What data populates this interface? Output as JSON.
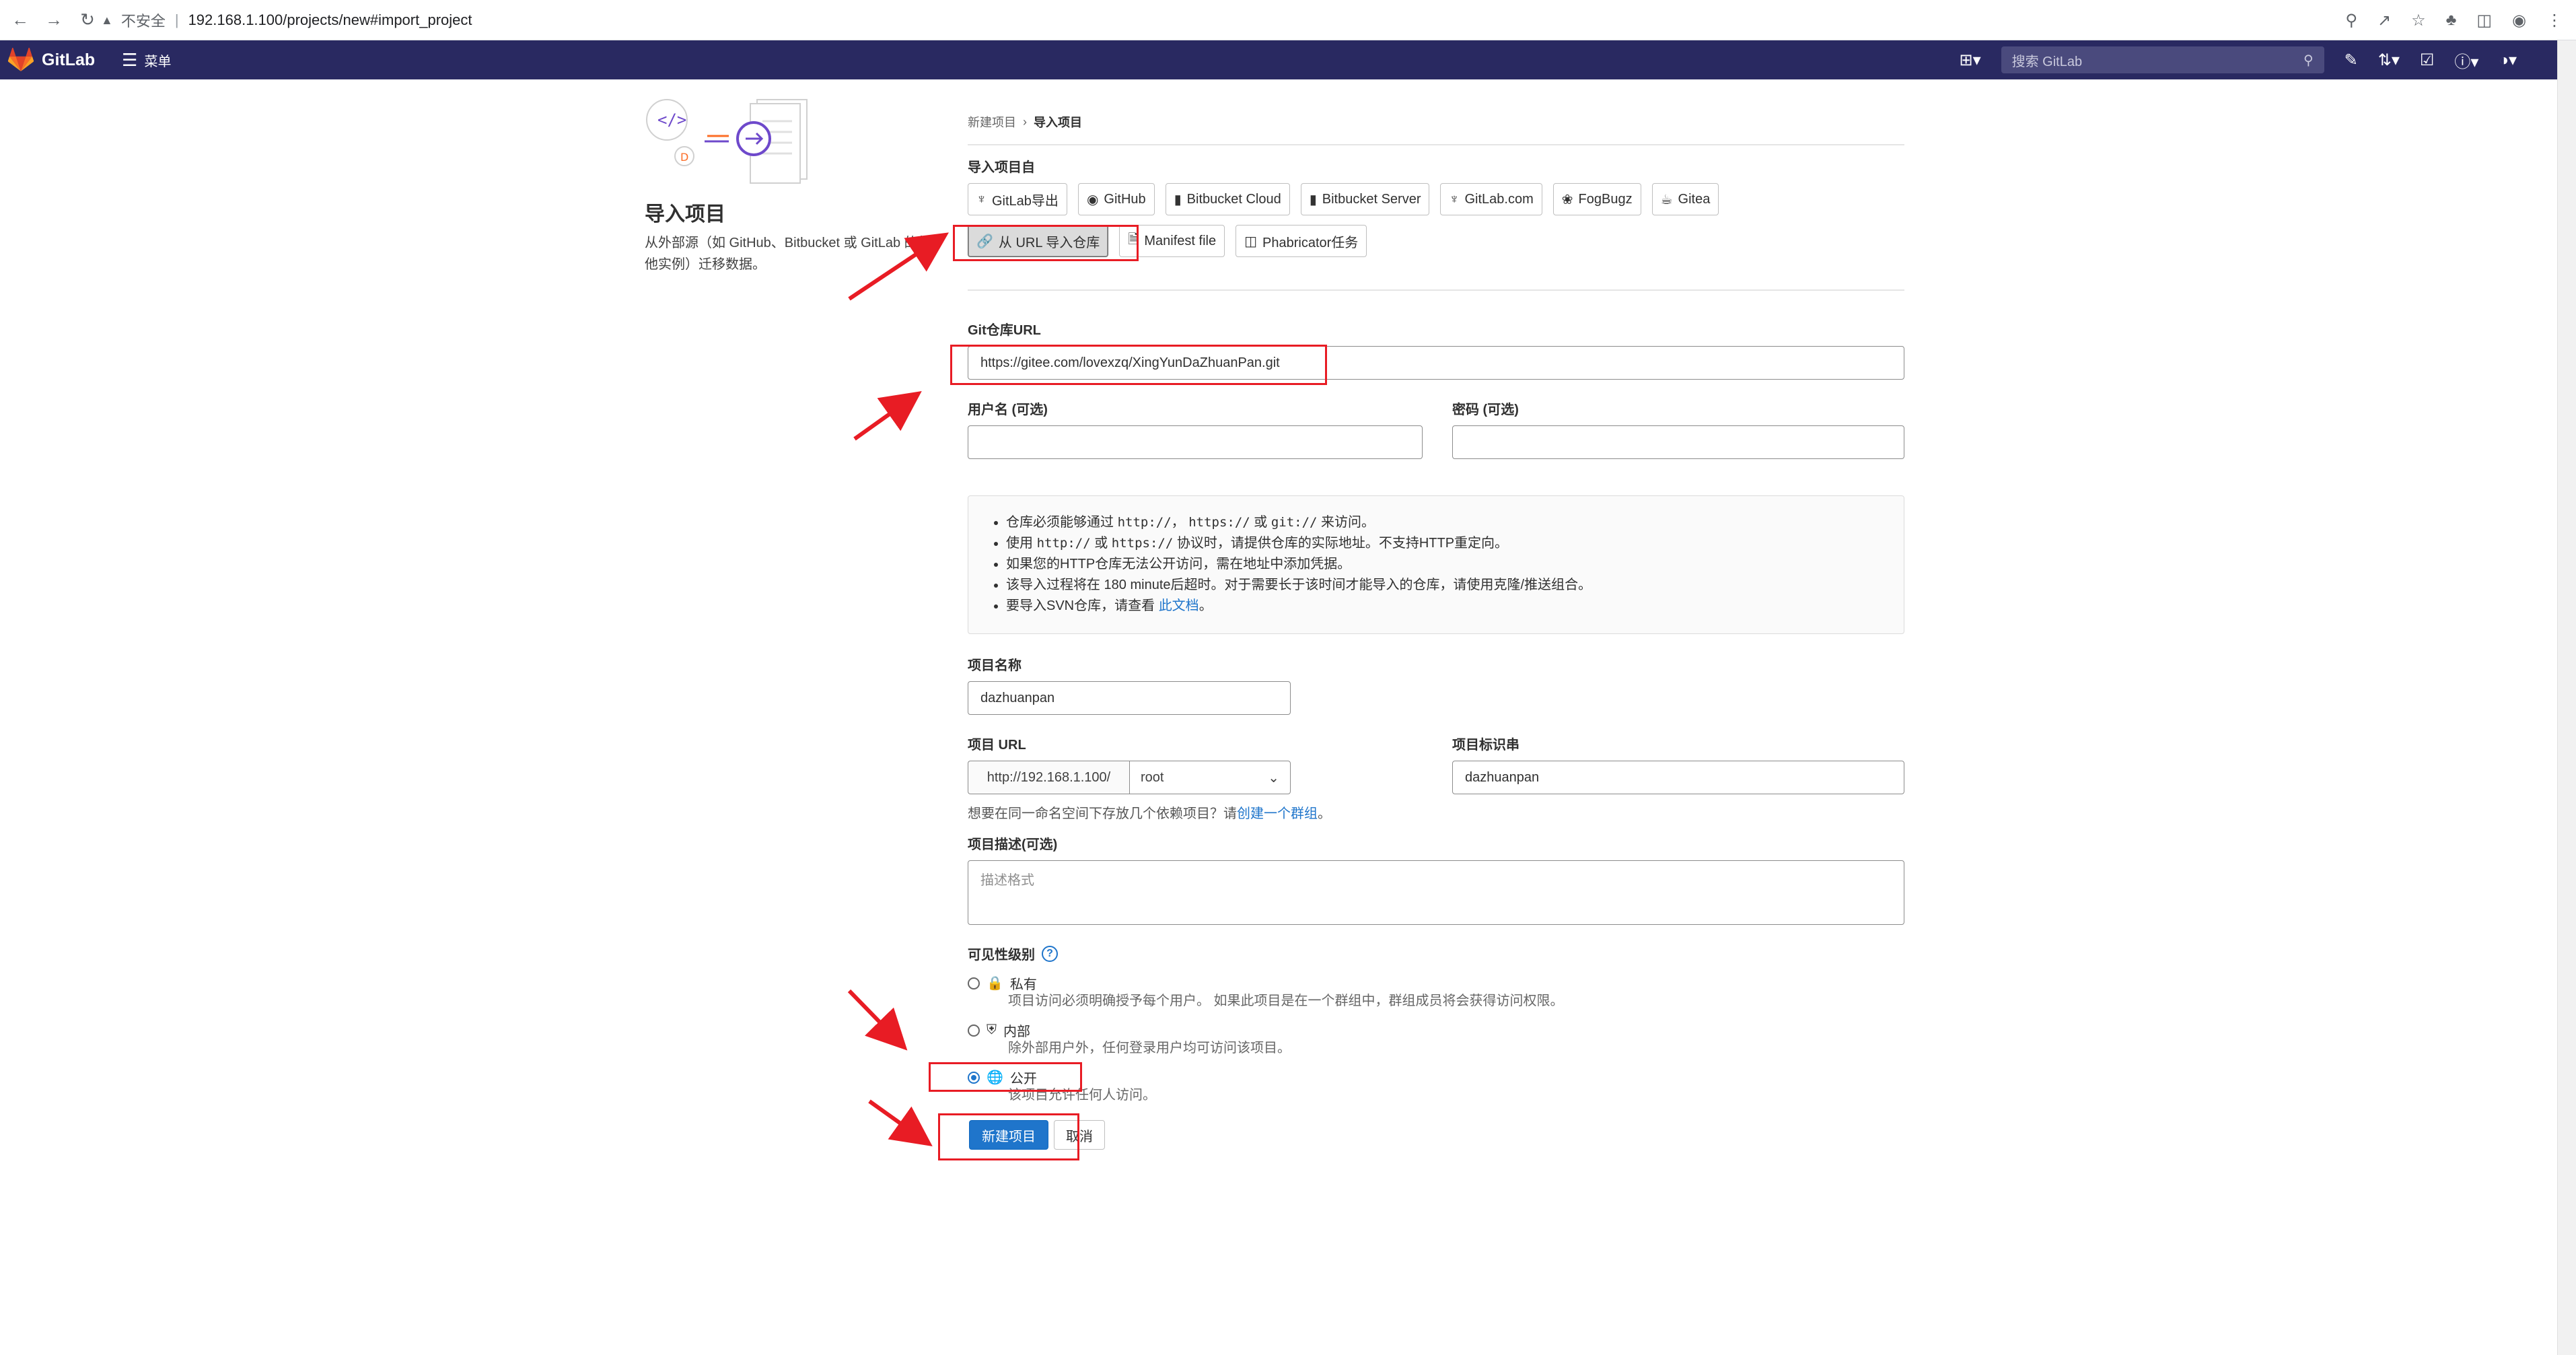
{
  "browser": {
    "back_icon": "arrow-left-icon",
    "forward_icon": "arrow-right-icon",
    "reload_icon": "reload-icon",
    "insecure_label": "不安全",
    "url": "192.168.1.100/projects/new#import_project"
  },
  "gitlab_nav": {
    "brand": "GitLab",
    "menu_label": "菜单",
    "search_placeholder": "搜索 GitLab"
  },
  "sidebar": {
    "title": "导入项目",
    "description": "从外部源（如 GitHub、Bitbucket 或 GitLab 的其他实例）迁移数据。"
  },
  "breadcrumb": {
    "parent": "新建项目",
    "current": "导入项目"
  },
  "import_from": {
    "label": "导入项目自",
    "sources_row1": [
      {
        "label": "GitLab导出",
        "icon": "tanuki-icon"
      },
      {
        "label": "GitHub",
        "icon": "github-icon"
      },
      {
        "label": "Bitbucket Cloud",
        "icon": "bitbucket-icon"
      },
      {
        "label": "Bitbucket Server",
        "icon": "bitbucket-icon"
      },
      {
        "label": "GitLab.com",
        "icon": "tanuki-icon"
      },
      {
        "label": "FogBugz",
        "icon": "bug-icon"
      },
      {
        "label": "Gitea",
        "icon": "gitea-icon"
      }
    ],
    "sources_row2": [
      {
        "label": "从 URL 导入仓库",
        "icon": "link-icon",
        "active": true
      },
      {
        "label": "Manifest file",
        "icon": "file-icon"
      },
      {
        "label": "Phabricator任务",
        "icon": "phabricator-icon"
      }
    ]
  },
  "repo_url": {
    "label": "Git仓库URL",
    "value": "https://gitee.com/lovexzq/XingYunDaZhuanPan.git"
  },
  "username": {
    "label": "用户名 (可选)",
    "value": ""
  },
  "password": {
    "label": "密码 (可选)",
    "value": ""
  },
  "info": {
    "line1_prefix": "仓库必须能够通过 ",
    "line1_code1": "http://",
    "line1_mid1": "， ",
    "line1_code2": "https://",
    "line1_mid2": " 或 ",
    "line1_code3": "git://",
    "line1_suffix": " 来访问。",
    "line2_prefix": "使用 ",
    "line2_code1": "http://",
    "line2_mid": " 或 ",
    "line2_code2": "https://",
    "line2_suffix": " 协议时，请提供仓库的实际地址。不支持HTTP重定向。",
    "line3": "如果您的HTTP仓库无法公开访问，需在地址中添加凭据。",
    "line4": "该导入过程将在 180 minute后超时。对于需要长于该时间才能导入的仓库，请使用克隆/推送组合。",
    "line5_prefix": "要导入SVN仓库，请查看 ",
    "line5_link": "此文档",
    "line5_suffix": "。"
  },
  "project_name": {
    "label": "项目名称",
    "value": "dazhuanpan"
  },
  "project_url": {
    "label": "项目 URL",
    "prefix": "http://192.168.1.100/",
    "namespace": "root"
  },
  "project_slug": {
    "label": "项目标识串",
    "value": "dazhuanpan"
  },
  "group_hint": {
    "prefix": "想要在同一命名空间下存放几个依赖项目？请",
    "link": "创建一个群组",
    "suffix": "。"
  },
  "description": {
    "label": "项目描述(可选)",
    "placeholder": "描述格式"
  },
  "visibility": {
    "label": "可见性级别",
    "options": [
      {
        "label": "私有",
        "icon": "lock-icon",
        "desc": "项目访问必须明确授予每个用户。 如果此项目是在一个群组中，群组成员将会获得访问权限。",
        "checked": false
      },
      {
        "label": "内部",
        "icon": "shield-icon",
        "desc": "除外部用户外，任何登录用户均可访问该项目。",
        "checked": false
      },
      {
        "label": "公开",
        "icon": "globe-icon",
        "desc": "该项目允许任何人访问。",
        "checked": true
      }
    ]
  },
  "actions": {
    "create_label": "新建项目",
    "cancel_label": "取消"
  },
  "colors": {
    "nav_bg": "#292961",
    "primary": "#1f75cb",
    "annotation": "#e81c24"
  }
}
